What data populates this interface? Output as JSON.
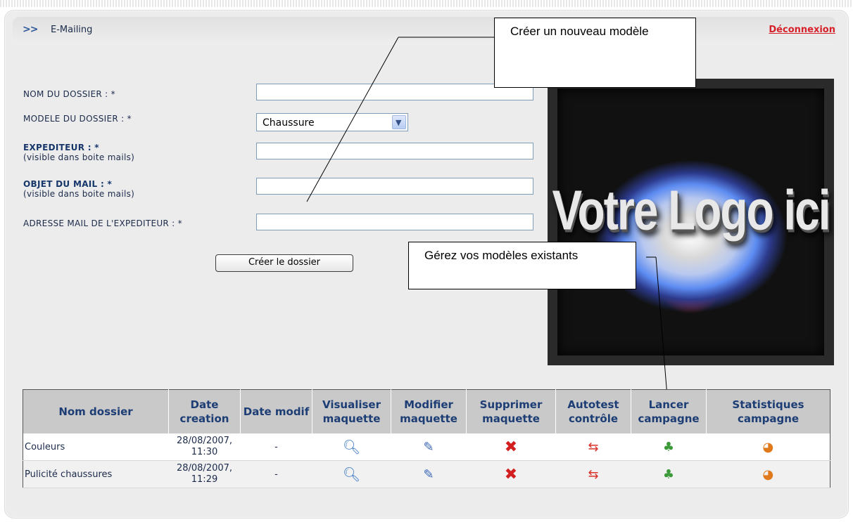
{
  "header": {
    "breadcrumb_arrows": ">>",
    "breadcrumb": "E-Mailing",
    "logout": "Déconnexion"
  },
  "form": {
    "nom_label": "NOM DU DOSSIER : *",
    "modele_label": "MODELE DU DOSSIER : *",
    "modele_value": "Chaussure",
    "expediteur_label": "EXPEDITEUR : *",
    "expediteur_sub": "(visible dans boite mails)",
    "objet_label": "OBJET DU MAIL : *",
    "objet_sub": "(visible dans boite mails)",
    "adresse_label": "ADRESSE MAIL DE L'EXPEDITEUR : *",
    "submit": "Créer le dossier"
  },
  "logo_text": "Votre Logo ici",
  "callouts": {
    "new_model": "Créer un nouveau modèle",
    "manage_models": "Gérez vos modèles existants"
  },
  "table": {
    "headers": [
      "Nom dossier",
      "Date creation",
      "Date modif",
      "Visualiser maquette",
      "Modifier maquette",
      "Supprimer maquette",
      "Autotest contrôle",
      "Lancer campagne",
      "Statistiques campagne"
    ],
    "rows": [
      {
        "name": "Couleurs",
        "date_creation": "28/08/2007, 11:30",
        "date_modif": "-"
      },
      {
        "name": "Pulicité chaussures",
        "date_creation": "28/08/2007, 11:29",
        "date_modif": "-"
      }
    ]
  },
  "icons": {
    "view": "magnifier-icon",
    "edit": "edit-page-icon",
    "delete": "delete-x-icon",
    "autotest": "arrows-exchange-icon",
    "launch": "user-add-icon",
    "stats": "pie-chart-icon"
  }
}
